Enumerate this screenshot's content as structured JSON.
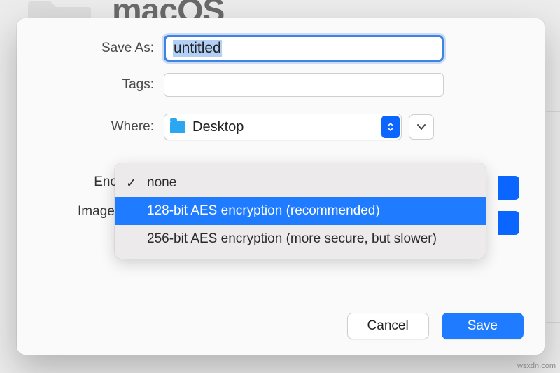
{
  "background": {
    "title": "macOS"
  },
  "dialog": {
    "saveas": {
      "label": "Save As:",
      "value": "untitled"
    },
    "tags": {
      "label": "Tags:",
      "value": ""
    },
    "where": {
      "label": "Where:",
      "location": "Desktop"
    },
    "encryption": {
      "label": "Encryption",
      "options": [
        {
          "label": "none",
          "checked": true,
          "selected": false
        },
        {
          "label": "128-bit AES encryption (recommended)",
          "checked": false,
          "selected": true
        },
        {
          "label": "256-bit AES encryption (more secure, but slower)",
          "checked": false,
          "selected": false
        }
      ]
    },
    "imageformat": {
      "label": "Image Forma"
    },
    "buttons": {
      "cancel": "Cancel",
      "save": "Save"
    }
  },
  "watermark": "wsxdn.com"
}
